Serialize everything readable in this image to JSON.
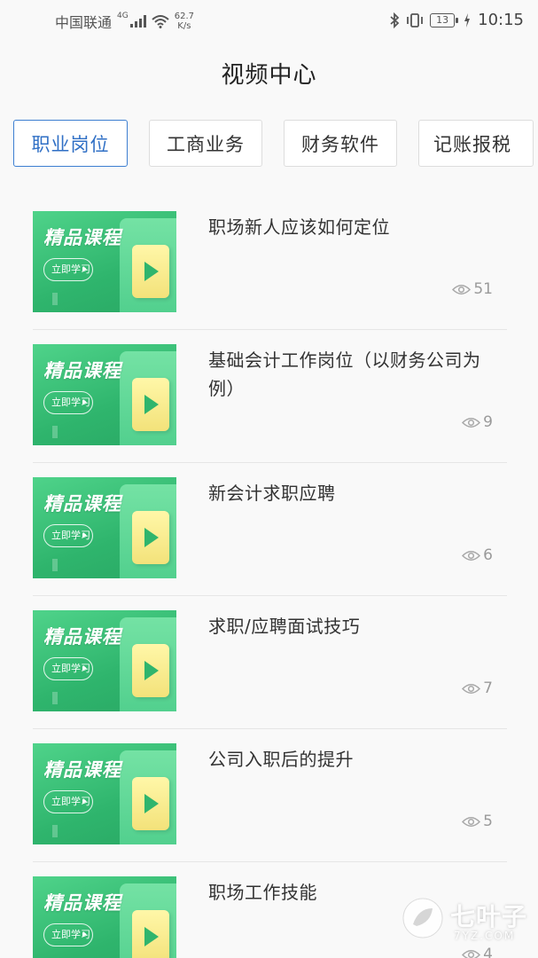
{
  "status_bar": {
    "carrier": "中国联通",
    "network_badge": "4G",
    "net_speed_value": "62.7",
    "net_speed_unit": "K/s",
    "battery": "13",
    "time": "10:15",
    "icons": [
      "signal-icon",
      "wifi-icon",
      "bluetooth-icon",
      "vibrate-icon",
      "battery-icon",
      "charging-icon"
    ]
  },
  "header": {
    "title": "视频中心"
  },
  "tabs": [
    {
      "label": "职业岗位",
      "active": true
    },
    {
      "label": "工商业务",
      "active": false
    },
    {
      "label": "财务软件",
      "active": false
    },
    {
      "label": "记账报税",
      "active": false
    }
  ],
  "thumbnail": {
    "title": "精品课程",
    "button": "立即学习"
  },
  "videos": [
    {
      "title": "职场新人应该如何定位",
      "views": "51"
    },
    {
      "title": "基础会计工作岗位（以财务公司为例）",
      "views": "9"
    },
    {
      "title": "新会计求职应聘",
      "views": "6"
    },
    {
      "title": "求职/应聘面试技巧",
      "views": "7"
    },
    {
      "title": "公司入职后的提升",
      "views": "5"
    },
    {
      "title": "职场工作技能",
      "views": "4"
    }
  ],
  "watermark": {
    "name": "七叶子",
    "domain": "7YZ.COM"
  },
  "colors": {
    "accent": "#3d7fd1",
    "thumb_green": "#2fb56d",
    "play_yellow": "#f3e27a"
  }
}
